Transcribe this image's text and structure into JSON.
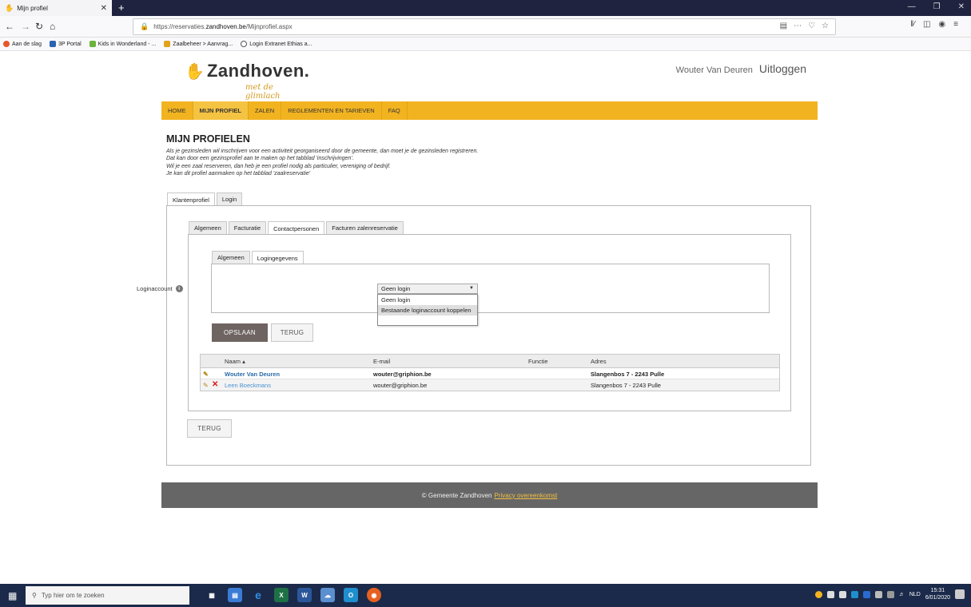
{
  "browser": {
    "tab_title": "Mijn profiel",
    "url_prefix": "https://reservaties.",
    "url_host": "zandhoven.be",
    "url_path": "/Mijnprofiel.aspx",
    "bookmarks": [
      "Aan de slag",
      "3P Portal",
      "Kids in Wonderland - ...",
      "Zaalbeheer > Aanvrag...",
      "Login Extranet Ethias a..."
    ]
  },
  "site": {
    "logo_name": "Zandhoven.",
    "logo_tagline": "met de glimlach",
    "user_name": "Wouter Van Deuren",
    "logout_label": "Uitloggen",
    "menu": [
      "HOME",
      "MIJN PROFIEL",
      "ZALEN",
      "REGLEMENTEN EN TARIEVEN",
      "FAQ"
    ],
    "active_menu_index": 1
  },
  "main": {
    "heading": "MIJN PROFIELEN",
    "intro_lines": [
      "Als je gezinsleden wil inschrijven voor een activiteit georganiseerd door de gemeente, dan moet je de gezinsleden registreren.",
      "Dat kan door een gezinsprofiel aan te maken op het tabblad 'inschrijvingen'.",
      "Wil je een zaal reserveren, dan heb je een profiel nodig als particulier, vereniging of bedrijf.",
      "Je kan dit profiel aanmaken op het tabblad 'zaalreservatie'"
    ],
    "outer_tabs": [
      "Klantenprofiel",
      "Login"
    ],
    "middle_tabs": [
      "Algemeen",
      "Facturatie",
      "Contactpersonen",
      "Facturen zalenreservatie"
    ],
    "inner_tabs": [
      "Algemeen",
      "Logingegevens"
    ],
    "form": {
      "login_label": "Loginaccount",
      "selected": "Geen login",
      "options": [
        "Geen login",
        "Bestaande loginaccount koppelen"
      ]
    },
    "buttons": {
      "save": "OPSLAAN",
      "back": "TERUG",
      "back_bottom": "TERUG"
    },
    "table": {
      "columns": [
        "Naam ▴",
        "E-mail",
        "Functie",
        "Adres"
      ],
      "rows": [
        {
          "name": "Wouter Van Deuren",
          "email": "wouter@griphion.be",
          "function": "",
          "address": "Slangenbos 7 - 2243 Pulle"
        },
        {
          "name": "Leen Boeckmans",
          "email": "wouter@griphion.be",
          "function": "",
          "address": "Slangenbos 7 - 2243 Pulle"
        }
      ]
    }
  },
  "footer": {
    "copyright": "© Gemeente Zandhoven",
    "privacy_link": "Privacy overeenkomst"
  },
  "taskbar": {
    "search_placeholder": "Typ hier om te zoeken",
    "language": "NLD",
    "time": "15:31",
    "date": "6/01/2020"
  },
  "colors": {
    "menu_bar": "#f2b320",
    "save_button": "#6e6461",
    "footer": "#666666",
    "link": "#2b6aa8"
  }
}
